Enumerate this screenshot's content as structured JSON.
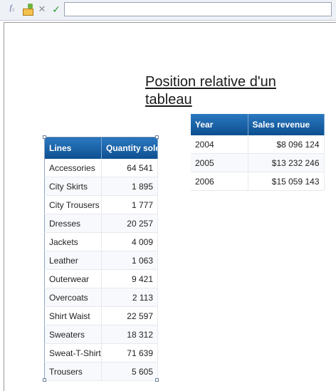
{
  "toolbar": {
    "icons": [
      "formula-icon",
      "variable-icon",
      "cancel-icon",
      "validate-icon"
    ],
    "formula_value": ""
  },
  "report": {
    "title": "Position relative d'un tableau"
  },
  "lines_table": {
    "headers": [
      "Lines",
      "Quantity sold"
    ],
    "rows": [
      [
        "Accessories",
        "64 541"
      ],
      [
        "City Skirts",
        "1 895"
      ],
      [
        "City Trousers",
        "1 777"
      ],
      [
        "Dresses",
        "20 257"
      ],
      [
        "Jackets",
        "4 009"
      ],
      [
        "Leather",
        "1 063"
      ],
      [
        "Outerwear",
        "9 421"
      ],
      [
        "Overcoats",
        "2 113"
      ],
      [
        "Shirt Waist",
        "22 597"
      ],
      [
        "Sweaters",
        "18 312"
      ],
      [
        "Sweat-T-Shirts",
        "71 639"
      ],
      [
        "Trousers",
        "5 605"
      ]
    ]
  },
  "year_table": {
    "headers": [
      "Year",
      "Sales revenue"
    ],
    "rows": [
      [
        "2004",
        "$8 096 124"
      ],
      [
        "2005",
        "$13 232 246"
      ],
      [
        "2006",
        "$15 059 143"
      ]
    ]
  },
  "colors": {
    "header_top": "#2b78c0",
    "header_bottom": "#0d4f8f",
    "header_text": "#ffffff",
    "row_alt": "#f7f9fc"
  }
}
